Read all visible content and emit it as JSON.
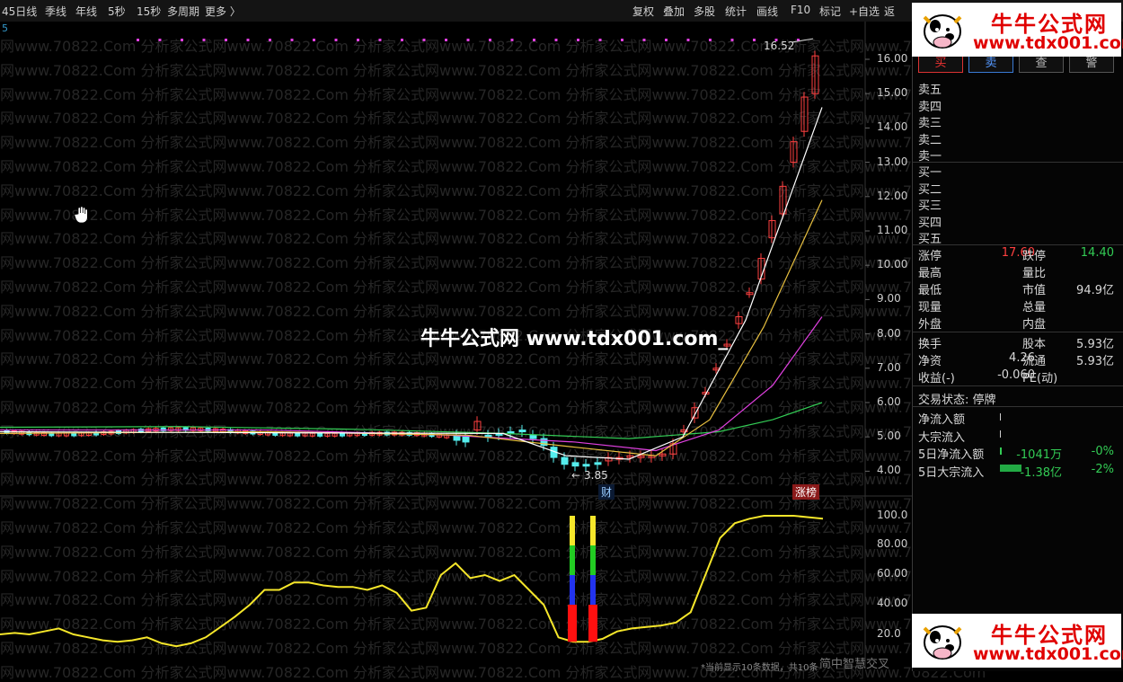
{
  "toolbar": {
    "periods": [
      "45日线",
      "季线",
      "年线",
      "5秒",
      "15秒",
      "多周期",
      "更多 〉"
    ],
    "tools": [
      "复权",
      "叠加",
      "多股",
      "统计",
      "画线",
      "F10",
      "标记",
      "+自选",
      "返"
    ]
  },
  "main_chart": {
    "corner_label": "5",
    "price_axis": [
      "16.00",
      "15.00",
      "14.00",
      "13.00",
      "12.00",
      "11.00",
      "10.00",
      "9.00",
      "8.00",
      "7.00",
      "6.00",
      "5.00",
      "4.00"
    ],
    "high_label": "16.52",
    "low_label": "3.85",
    "badge_cai": "财",
    "badge_zhangbang": "涨榜",
    "center_watermark": "牛牛公式网 www.tdx001.com_",
    "watermark_text": "网www.70822.Com 分析家公式网www.70822.Com 分析家公式网www.70822.Com 分析家公式网www.70822.Com 分析家公式网www.70822.Com"
  },
  "sub_chart": {
    "axis": [
      "100.0",
      "80.00",
      "60.00",
      "40.00",
      "20.0"
    ],
    "bottom_text": "简中智慧交叉"
  },
  "chart_data": {
    "type": "line",
    "ylim": [
      15,
      100
    ],
    "series": [
      {
        "values": [
          20,
          21,
          20,
          22,
          24,
          20,
          18,
          16,
          15,
          16,
          18,
          14,
          12,
          14,
          18,
          25,
          32,
          40,
          50,
          50,
          55,
          55,
          53,
          52,
          52,
          50,
          53,
          48,
          36,
          38,
          60,
          68,
          58,
          60,
          56,
          60,
          50,
          40,
          18,
          15,
          15,
          17,
          22,
          24,
          25,
          26,
          28,
          35,
          60,
          85,
          95,
          98,
          100,
          100,
          100,
          99,
          98
        ]
      }
    ],
    "color": "#f5e62a"
  },
  "panel": {
    "tabs": [
      "买",
      "卖",
      "查",
      "警"
    ],
    "sell_levels": [
      "卖五",
      "卖四",
      "卖三",
      "卖二",
      "卖一"
    ],
    "buy_levels": [
      "买一",
      "买二",
      "买三",
      "买四",
      "买五"
    ],
    "stats": [
      {
        "l1": "涨停",
        "v1": "17.60",
        "c1": "#ff4040",
        "l2": "跌停",
        "v2": "14.40",
        "c2": "#33cc55"
      },
      {
        "l1": "最高",
        "v1": "",
        "c1": "#d8d8d8",
        "l2": "量比",
        "v2": "",
        "c2": "#d8d8d8"
      },
      {
        "l1": "最低",
        "v1": "",
        "c1": "#d8d8d8",
        "l2": "市值",
        "v2": "94.9亿",
        "c2": "#d8d8d8"
      },
      {
        "l1": "现量",
        "v1": "",
        "c1": "#d8d8d8",
        "l2": "总量",
        "v2": "",
        "c2": "#d8d8d8"
      },
      {
        "l1": "外盘",
        "v1": "",
        "c1": "#d8d8d8",
        "l2": "内盘",
        "v2": "",
        "c2": "#d8d8d8"
      }
    ],
    "stats2": [
      {
        "l1": "换手",
        "v1": "",
        "l2": "股本",
        "v2": "5.93亿"
      },
      {
        "l1": "净资",
        "v1": "4.26",
        "l2": "流通",
        "v2": "5.93亿"
      },
      {
        "l1": "收益(-)",
        "v1": "-0.060",
        "l2": "PE(动)",
        "v2": ""
      }
    ],
    "trade_status": "交易状态: 停牌",
    "flows": [
      {
        "label": "净流入额",
        "value": "",
        "pct": ""
      },
      {
        "label": "大宗流入",
        "value": "",
        "pct": ""
      },
      {
        "label": "5日净流入额",
        "value": "-1041万",
        "pct": "-0%"
      },
      {
        "label": "5日大宗流入",
        "value": "-1.38亿",
        "pct": "-2%"
      }
    ]
  },
  "logo": {
    "title": "牛牛公式网",
    "url": "www.tdx001.com"
  }
}
